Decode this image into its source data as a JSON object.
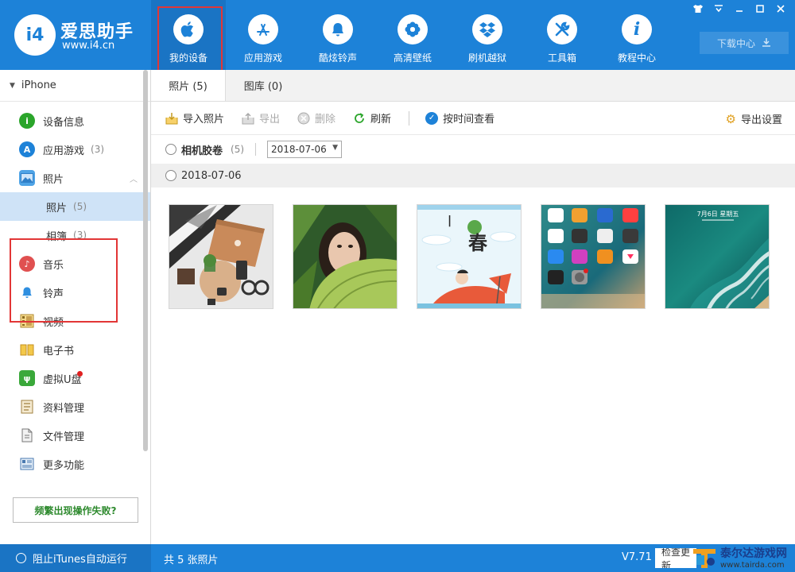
{
  "app": {
    "logo_mark": "i4",
    "logo_name": "爱思助手",
    "logo_url": "www.i4.cn"
  },
  "nav": [
    {
      "label": "我的设备",
      "icon": "apple-icon",
      "active": true
    },
    {
      "label": "应用游戏",
      "icon": "app-store-icon"
    },
    {
      "label": "酷炫铃声",
      "icon": "bell-icon"
    },
    {
      "label": "高清壁纸",
      "icon": "flower-icon"
    },
    {
      "label": "刷机越狱",
      "icon": "dropbox-icon"
    },
    {
      "label": "工具箱",
      "icon": "tools-icon"
    },
    {
      "label": "教程中心",
      "icon": "info-icon"
    }
  ],
  "download": {
    "label": "下载中心"
  },
  "sidebar": {
    "device": "iPhone",
    "items": [
      {
        "label": "设备信息",
        "icon": "info-icon",
        "color": "#2aa52a"
      },
      {
        "label": "应用游戏",
        "count": "(3)",
        "icon": "app-store-icon",
        "color": "#1d82d8"
      },
      {
        "label": "照片",
        "icon": "photo-icon",
        "color": "#4ea3e6"
      },
      {
        "label": "照片",
        "count": "(5)",
        "sub": true,
        "active": true
      },
      {
        "label": "相簿",
        "count": "(3)",
        "sub": true
      },
      {
        "label": "音乐",
        "icon": "music-icon",
        "color": "#e05050"
      },
      {
        "label": "铃声",
        "icon": "bell-icon",
        "color": "#2f8fe0"
      },
      {
        "label": "视频",
        "icon": "video-icon",
        "color": "#d0a040"
      },
      {
        "label": "电子书",
        "icon": "book-icon",
        "color": "#e6b040"
      },
      {
        "label": "虚拟U盘",
        "icon": "usb-icon",
        "color": "#3aa83a",
        "dot": true
      },
      {
        "label": "资料管理",
        "icon": "contacts-icon",
        "color": "#c0a060"
      },
      {
        "label": "文件管理",
        "icon": "file-icon",
        "color": "#8a8a8a"
      },
      {
        "label": "更多功能",
        "icon": "more-icon",
        "color": "#5a8ac0"
      }
    ],
    "help_button": "频繁出现操作失败?"
  },
  "tabs": [
    {
      "label": "照片 (5)",
      "active": true
    },
    {
      "label": "图库 (0)"
    }
  ],
  "toolbar": {
    "import": "导入照片",
    "export": "导出",
    "delete": "删除",
    "refresh": "刷新",
    "by_time": "按时间查看",
    "export_settings": "导出设置"
  },
  "filter": {
    "camera_roll": "相机胶卷",
    "camera_count": "(5)",
    "date": "2018-07-06"
  },
  "group": {
    "date": "2018-07-06"
  },
  "photos": [
    {
      "name": "laptop-flatlay"
    },
    {
      "name": "girl-with-leaf"
    },
    {
      "name": "spring-cartoon",
      "text": "春"
    },
    {
      "name": "iphone-homescreen"
    },
    {
      "name": "ocean-lockscreen",
      "text": "7月6日 星期五"
    }
  ],
  "status": {
    "itunes": "阻止iTunes自动运行",
    "count": "共 5 张照片",
    "version": "V7.71",
    "check": "检查更新"
  },
  "watermark": {
    "name": "泰尔达游戏网",
    "url": "www.tairda.com"
  }
}
